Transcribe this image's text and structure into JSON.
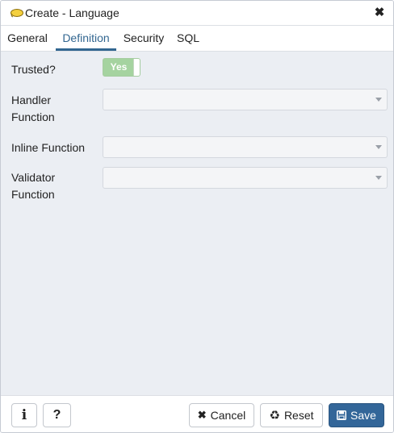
{
  "dialog": {
    "title": "Create - Language",
    "title_icon": "elephant-icon",
    "close_icon": "close-icon"
  },
  "tabs": [
    {
      "label": "General",
      "active": false
    },
    {
      "label": "Definition",
      "active": true
    },
    {
      "label": "Security",
      "active": false
    },
    {
      "label": "SQL",
      "active": false
    }
  ],
  "form": {
    "trusted": {
      "label": "Trusted?",
      "value": "Yes",
      "checked": true
    },
    "handler_function": {
      "label_line1": "Handler",
      "label_line2": "Function",
      "value": ""
    },
    "inline_function": {
      "label": "Inline Function",
      "value": ""
    },
    "validator_function": {
      "label_line1": "Validator",
      "label_line2": "Function",
      "value": ""
    }
  },
  "footer": {
    "info_icon": "info-icon",
    "help_icon": "help-icon",
    "cancel_label": "Cancel",
    "reset_label": "Reset",
    "save_label": "Save"
  },
  "colors": {
    "accent": "#326690",
    "save_button": "#336699",
    "toggle_on": "#a5d3a0",
    "body_bg": "#ebeef3"
  }
}
